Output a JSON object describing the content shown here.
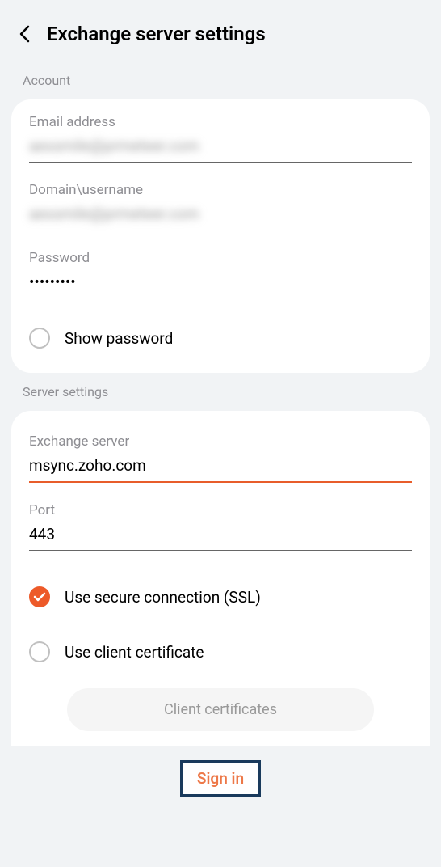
{
  "header": {
    "title": "Exchange server settings"
  },
  "account": {
    "section_label": "Account",
    "email_label": "Email address",
    "email_value": "aexsmile@prmeteer.com",
    "domain_label": "Domain\\username",
    "domain_value": "aexsmile@prmeteer.com",
    "password_label": "Password",
    "password_value": "•••••••••",
    "show_password_label": "Show password"
  },
  "server": {
    "section_label": "Server settings",
    "exchange_label": "Exchange server",
    "exchange_value": "msync.zoho.com",
    "port_label": "Port",
    "port_value": "443",
    "ssl_label": "Use secure connection (SSL)",
    "client_cert_label": "Use client certificate",
    "client_cert_button": "Client certificates"
  },
  "footer": {
    "signin_label": "Sign in"
  }
}
